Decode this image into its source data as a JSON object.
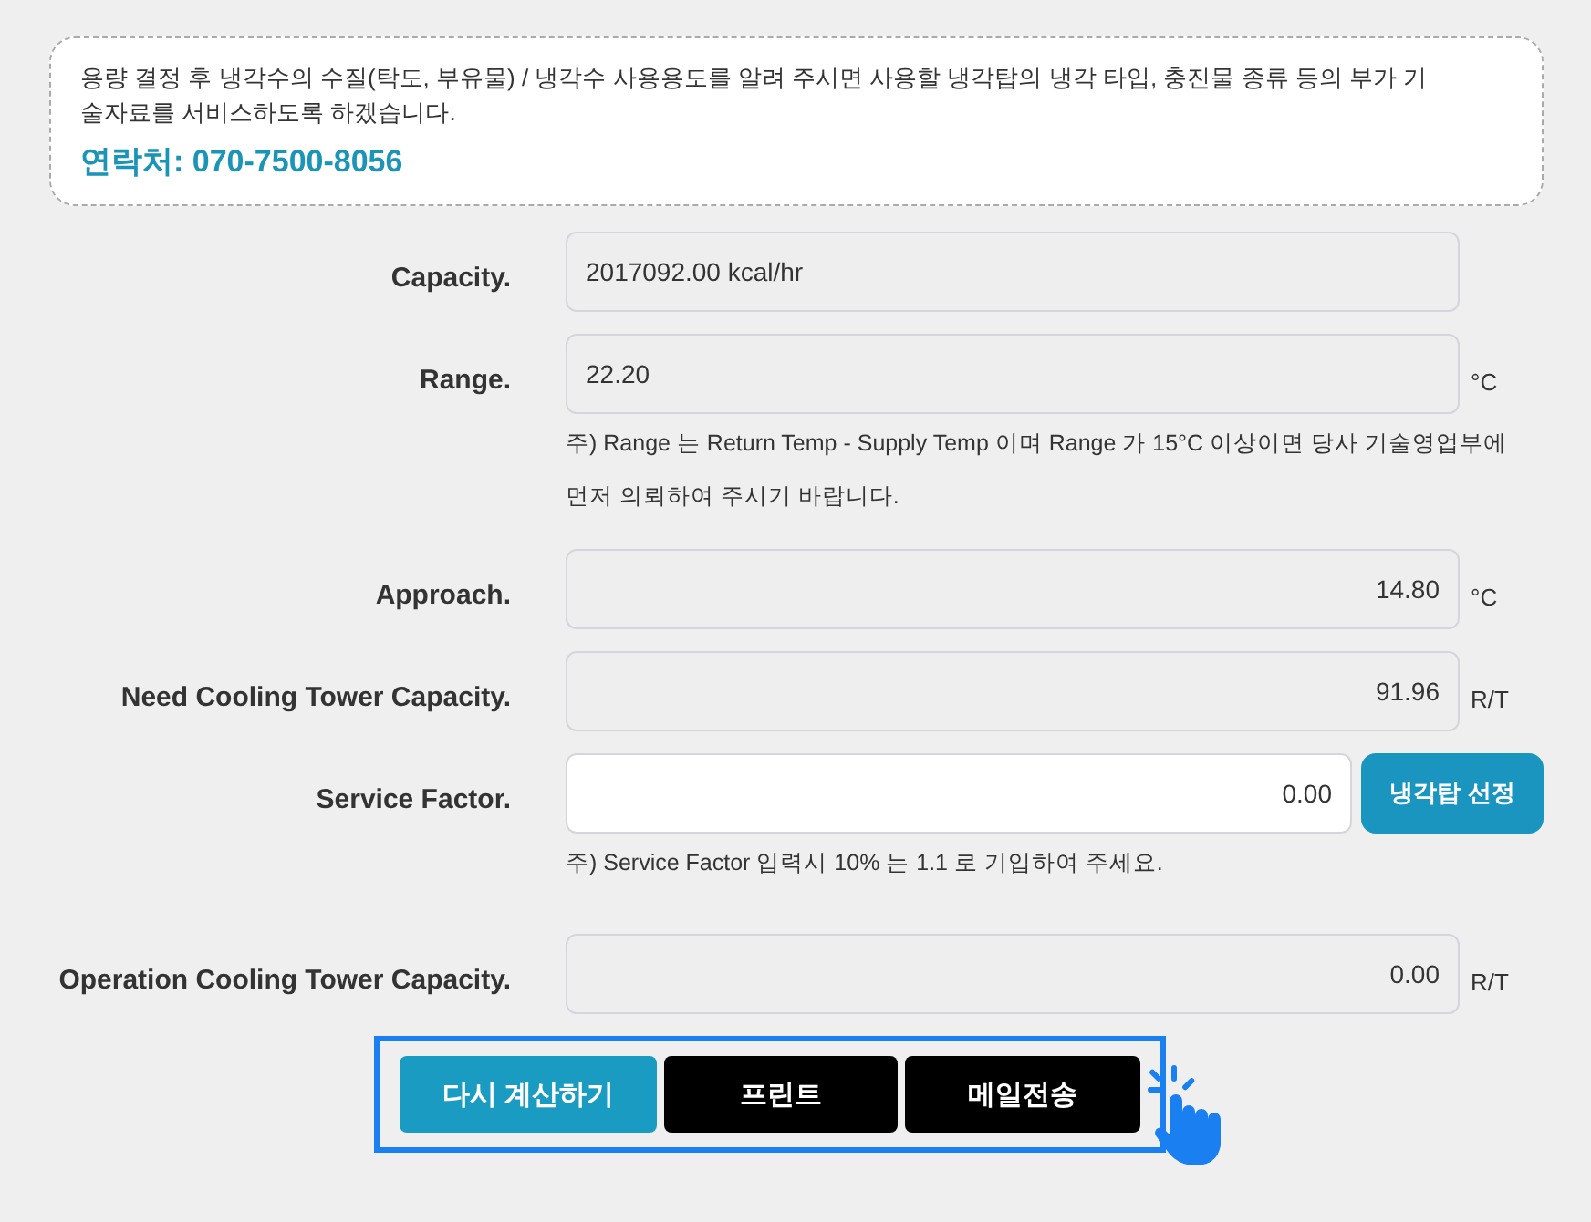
{
  "notice": {
    "text": "용량 결정 후 냉각수의 수질(탁도, 부유물) / 냉각수 사용용도를 알려 주시면 사용할 냉각탑의 냉각 타입, 충진물 종류 등의 부가 기술자료를 서비스하도록 하겠습니다.",
    "contact": "연락처: 070-7500-8056"
  },
  "rows": [
    {
      "label": "Capacity.",
      "kind": "text",
      "readonly": true,
      "value": "2017092.00 kcal/hr"
    },
    {
      "label": "Range.",
      "kind": "text",
      "readonly": true,
      "value": "22.20",
      "unit": "°C",
      "note": "주) Range 는 Return Temp - Supply Temp 이며 Range 가 15°C 이상이면 당사 기술영업부에 먼저 의뢰하여 주시기 바랍니다."
    },
    {
      "label": "Approach.",
      "kind": "number",
      "readonly": true,
      "value": "14.80",
      "unit": "°C"
    },
    {
      "label": "Need Cooling Tower Capacity.",
      "kind": "number",
      "readonly": true,
      "value": "91.96",
      "unit": "R/T"
    },
    {
      "label": "Service Factor.",
      "kind": "number",
      "readonly": false,
      "value": "0.00",
      "button": "냉각탑 선정",
      "note": "주) Service Factor 입력시 10% 는 1.1 로 기입하여 주세요."
    },
    {
      "label": "Operation Cooling Tower Capacity.",
      "kind": "number",
      "readonly": true,
      "value": "0.00",
      "unit": "R/T"
    }
  ],
  "actions": [
    {
      "label": "다시 계산하기",
      "kind": "primary"
    },
    {
      "label": "프린트",
      "kind": "dark"
    },
    {
      "label": "메일전송",
      "kind": "dark"
    }
  ]
}
